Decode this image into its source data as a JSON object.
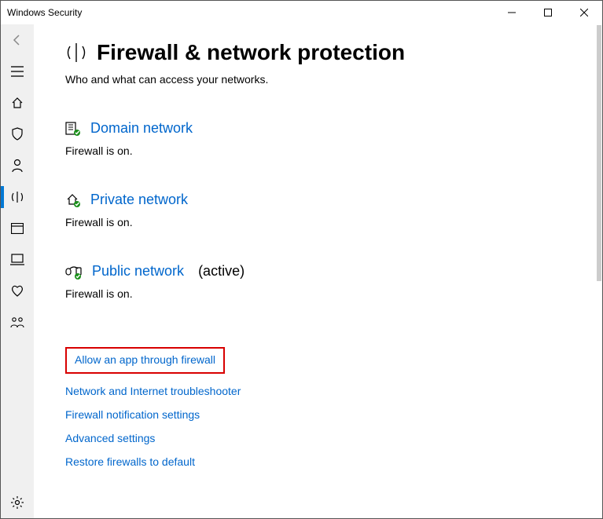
{
  "window": {
    "title": "Windows Security"
  },
  "page": {
    "title": "Firewall & network protection",
    "subtitle": "Who and what can access your networks."
  },
  "networks": {
    "domain": {
      "label": "Domain network",
      "status": "Firewall is on."
    },
    "private": {
      "label": "Private network",
      "status": "Firewall is on."
    },
    "public": {
      "label": "Public network",
      "active_suffix": "(active)",
      "status": "Firewall is on."
    }
  },
  "links": {
    "allow_app": "Allow an app through firewall",
    "troubleshooter": "Network and Internet troubleshooter",
    "notifications": "Firewall notification settings",
    "advanced": "Advanced settings",
    "restore": "Restore firewalls to default"
  }
}
